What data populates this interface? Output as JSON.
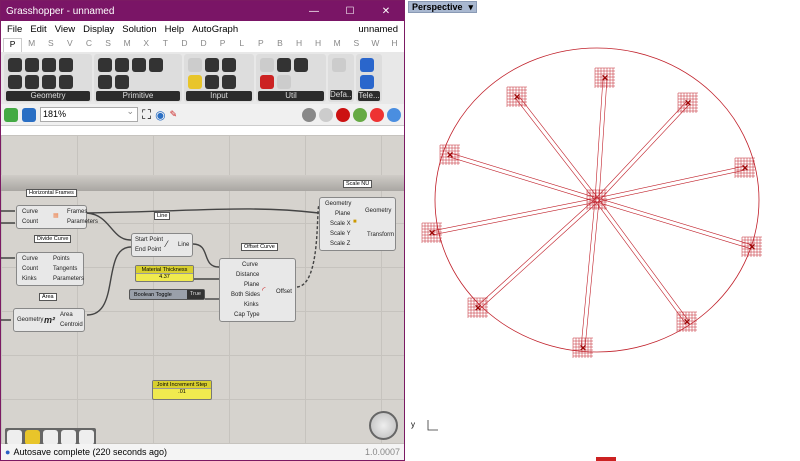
{
  "window": {
    "title": "Grasshopper - unnamed",
    "min": "—",
    "max": "☐",
    "close": "✕"
  },
  "menu": {
    "items": [
      "File",
      "Edit",
      "View",
      "Display",
      "Solution",
      "Help",
      "AutoGraph"
    ],
    "doc_name": "unnamed"
  },
  "tabs": [
    "P",
    "M",
    "S",
    "V",
    "C",
    "S",
    "M",
    "X",
    "T",
    "D",
    "D",
    "P",
    "L",
    "P",
    "B",
    "H",
    "H",
    "M",
    "S",
    "W",
    "H"
  ],
  "ribbon": {
    "groups": [
      "Geometry",
      "Primitive",
      "Input",
      "Util",
      "Defa...",
      "Tele..."
    ]
  },
  "toolbar": {
    "zoom": "181%"
  },
  "canvas": {
    "nodes": {
      "horizontal_frames": {
        "tag": "Horizontal Frames",
        "inputs": [
          "Curve",
          "Count"
        ],
        "outputs": [
          "Frames",
          "Parameters"
        ]
      },
      "divide_curve": {
        "tag": "Divide Curve",
        "inputs": [
          "Curve",
          "Count",
          "Kinks"
        ],
        "outputs": [
          "Points",
          "Tangents",
          "Parameters"
        ]
      },
      "area": {
        "tag": "Area",
        "inputs": [
          "Geometry"
        ],
        "outputs": [
          "Area",
          "Centroid"
        ]
      },
      "line": {
        "tag": "Line",
        "inputs": [
          "Start Point",
          "End Point"
        ],
        "outputs": [
          "Line"
        ]
      },
      "offset_curve": {
        "tag": "Offset Curve",
        "inputs": [
          "Curve",
          "Distance",
          "Plane",
          "Both Sides",
          "Kinks",
          "Cap Type"
        ],
        "outputs": [
          "Offset"
        ]
      },
      "scale_nu": {
        "tag": "Scale NU",
        "inputs": [
          "Geometry",
          "Plane",
          "Scale X",
          "Scale Y",
          "Scale Z"
        ],
        "outputs": [
          "Geometry",
          "Transform"
        ]
      }
    },
    "material_thickness": {
      "label": "Material Thickness",
      "value": "4.37"
    },
    "boolean_toggle": {
      "label": "Boolean Toggle",
      "value": "True"
    },
    "joint_increment": {
      "label": "Joint Increment Step",
      "value": ".01"
    }
  },
  "status": {
    "message": "Autosave complete (220 seconds ago)",
    "version": "1.0.0007"
  },
  "viewport": {
    "name": "Perspective",
    "axis_y": "y",
    "accent": "#c0202a"
  }
}
